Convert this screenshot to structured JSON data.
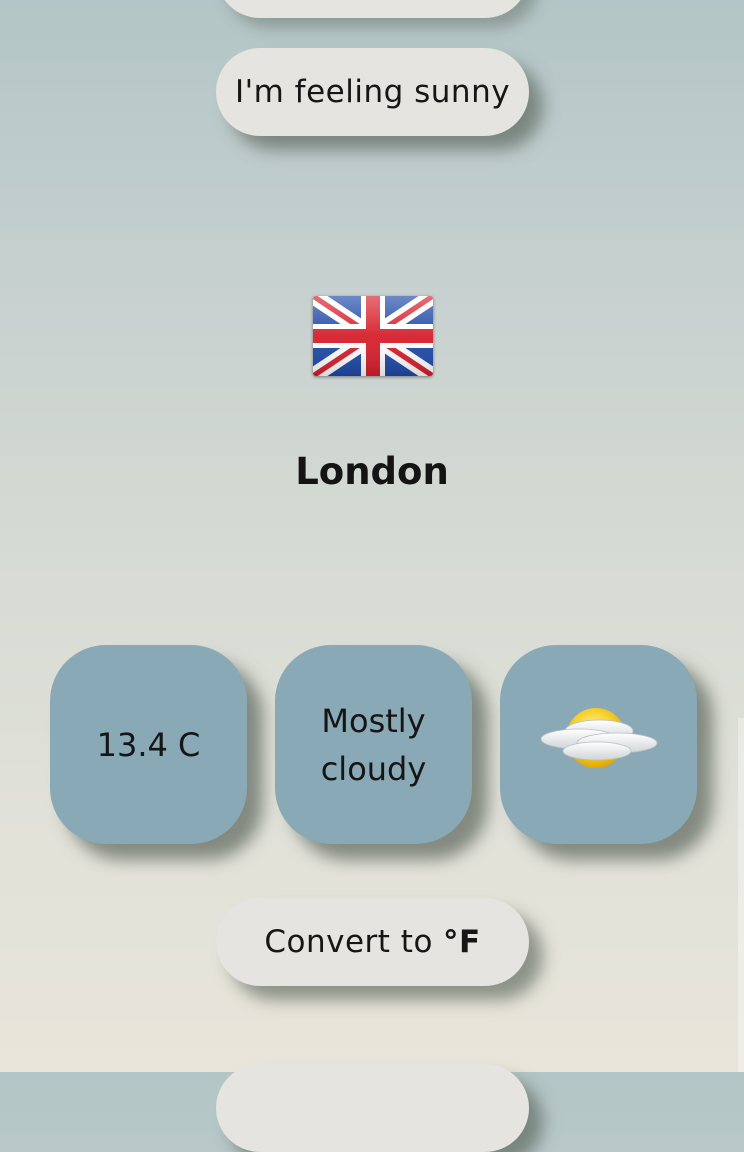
{
  "header": {
    "feeling_button_label": "I'm feeling sunny"
  },
  "location": {
    "flag_icon": "uk-flag-icon",
    "city": "London"
  },
  "weather": {
    "temperature": "13.4 C",
    "condition_line1": "Mostly",
    "condition_line2": "cloudy",
    "condition_icon": "partly-cloudy-icon"
  },
  "actions": {
    "convert_label": "Convert to",
    "convert_unit": "°F"
  },
  "colors": {
    "tile_background": "#88a9b5",
    "pill_background": "#e5e4e0"
  }
}
